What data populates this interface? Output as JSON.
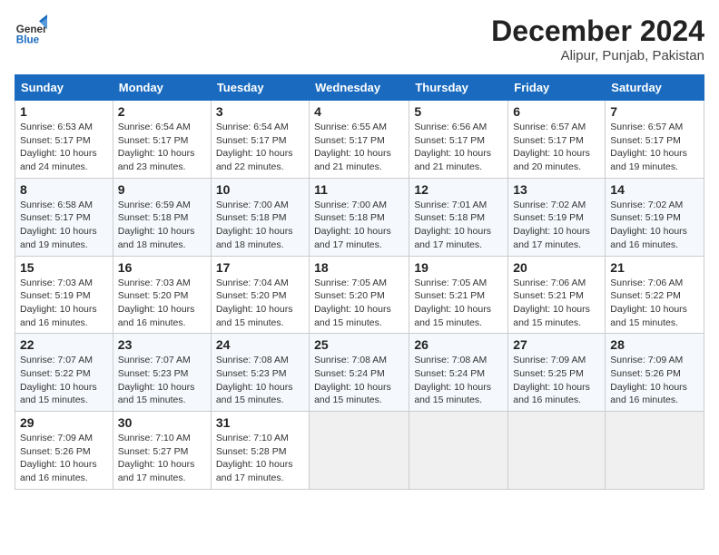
{
  "logo": {
    "line1": "General",
    "line2": "Blue"
  },
  "title": "December 2024",
  "subtitle": "Alipur, Punjab, Pakistan",
  "weekdays": [
    "Sunday",
    "Monday",
    "Tuesday",
    "Wednesday",
    "Thursday",
    "Friday",
    "Saturday"
  ],
  "weeks": [
    [
      {
        "day": "1",
        "info": "Sunrise: 6:53 AM\nSunset: 5:17 PM\nDaylight: 10 hours\nand 24 minutes."
      },
      {
        "day": "2",
        "info": "Sunrise: 6:54 AM\nSunset: 5:17 PM\nDaylight: 10 hours\nand 23 minutes."
      },
      {
        "day": "3",
        "info": "Sunrise: 6:54 AM\nSunset: 5:17 PM\nDaylight: 10 hours\nand 22 minutes."
      },
      {
        "day": "4",
        "info": "Sunrise: 6:55 AM\nSunset: 5:17 PM\nDaylight: 10 hours\nand 21 minutes."
      },
      {
        "day": "5",
        "info": "Sunrise: 6:56 AM\nSunset: 5:17 PM\nDaylight: 10 hours\nand 21 minutes."
      },
      {
        "day": "6",
        "info": "Sunrise: 6:57 AM\nSunset: 5:17 PM\nDaylight: 10 hours\nand 20 minutes."
      },
      {
        "day": "7",
        "info": "Sunrise: 6:57 AM\nSunset: 5:17 PM\nDaylight: 10 hours\nand 19 minutes."
      }
    ],
    [
      {
        "day": "8",
        "info": "Sunrise: 6:58 AM\nSunset: 5:17 PM\nDaylight: 10 hours\nand 19 minutes."
      },
      {
        "day": "9",
        "info": "Sunrise: 6:59 AM\nSunset: 5:18 PM\nDaylight: 10 hours\nand 18 minutes."
      },
      {
        "day": "10",
        "info": "Sunrise: 7:00 AM\nSunset: 5:18 PM\nDaylight: 10 hours\nand 18 minutes."
      },
      {
        "day": "11",
        "info": "Sunrise: 7:00 AM\nSunset: 5:18 PM\nDaylight: 10 hours\nand 17 minutes."
      },
      {
        "day": "12",
        "info": "Sunrise: 7:01 AM\nSunset: 5:18 PM\nDaylight: 10 hours\nand 17 minutes."
      },
      {
        "day": "13",
        "info": "Sunrise: 7:02 AM\nSunset: 5:19 PM\nDaylight: 10 hours\nand 17 minutes."
      },
      {
        "day": "14",
        "info": "Sunrise: 7:02 AM\nSunset: 5:19 PM\nDaylight: 10 hours\nand 16 minutes."
      }
    ],
    [
      {
        "day": "15",
        "info": "Sunrise: 7:03 AM\nSunset: 5:19 PM\nDaylight: 10 hours\nand 16 minutes."
      },
      {
        "day": "16",
        "info": "Sunrise: 7:03 AM\nSunset: 5:20 PM\nDaylight: 10 hours\nand 16 minutes."
      },
      {
        "day": "17",
        "info": "Sunrise: 7:04 AM\nSunset: 5:20 PM\nDaylight: 10 hours\nand 15 minutes."
      },
      {
        "day": "18",
        "info": "Sunrise: 7:05 AM\nSunset: 5:20 PM\nDaylight: 10 hours\nand 15 minutes."
      },
      {
        "day": "19",
        "info": "Sunrise: 7:05 AM\nSunset: 5:21 PM\nDaylight: 10 hours\nand 15 minutes."
      },
      {
        "day": "20",
        "info": "Sunrise: 7:06 AM\nSunset: 5:21 PM\nDaylight: 10 hours\nand 15 minutes."
      },
      {
        "day": "21",
        "info": "Sunrise: 7:06 AM\nSunset: 5:22 PM\nDaylight: 10 hours\nand 15 minutes."
      }
    ],
    [
      {
        "day": "22",
        "info": "Sunrise: 7:07 AM\nSunset: 5:22 PM\nDaylight: 10 hours\nand 15 minutes."
      },
      {
        "day": "23",
        "info": "Sunrise: 7:07 AM\nSunset: 5:23 PM\nDaylight: 10 hours\nand 15 minutes."
      },
      {
        "day": "24",
        "info": "Sunrise: 7:08 AM\nSunset: 5:23 PM\nDaylight: 10 hours\nand 15 minutes."
      },
      {
        "day": "25",
        "info": "Sunrise: 7:08 AM\nSunset: 5:24 PM\nDaylight: 10 hours\nand 15 minutes."
      },
      {
        "day": "26",
        "info": "Sunrise: 7:08 AM\nSunset: 5:24 PM\nDaylight: 10 hours\nand 15 minutes."
      },
      {
        "day": "27",
        "info": "Sunrise: 7:09 AM\nSunset: 5:25 PM\nDaylight: 10 hours\nand 16 minutes."
      },
      {
        "day": "28",
        "info": "Sunrise: 7:09 AM\nSunset: 5:26 PM\nDaylight: 10 hours\nand 16 minutes."
      }
    ],
    [
      {
        "day": "29",
        "info": "Sunrise: 7:09 AM\nSunset: 5:26 PM\nDaylight: 10 hours\nand 16 minutes."
      },
      {
        "day": "30",
        "info": "Sunrise: 7:10 AM\nSunset: 5:27 PM\nDaylight: 10 hours\nand 17 minutes."
      },
      {
        "day": "31",
        "info": "Sunrise: 7:10 AM\nSunset: 5:28 PM\nDaylight: 10 hours\nand 17 minutes."
      },
      null,
      null,
      null,
      null
    ]
  ]
}
